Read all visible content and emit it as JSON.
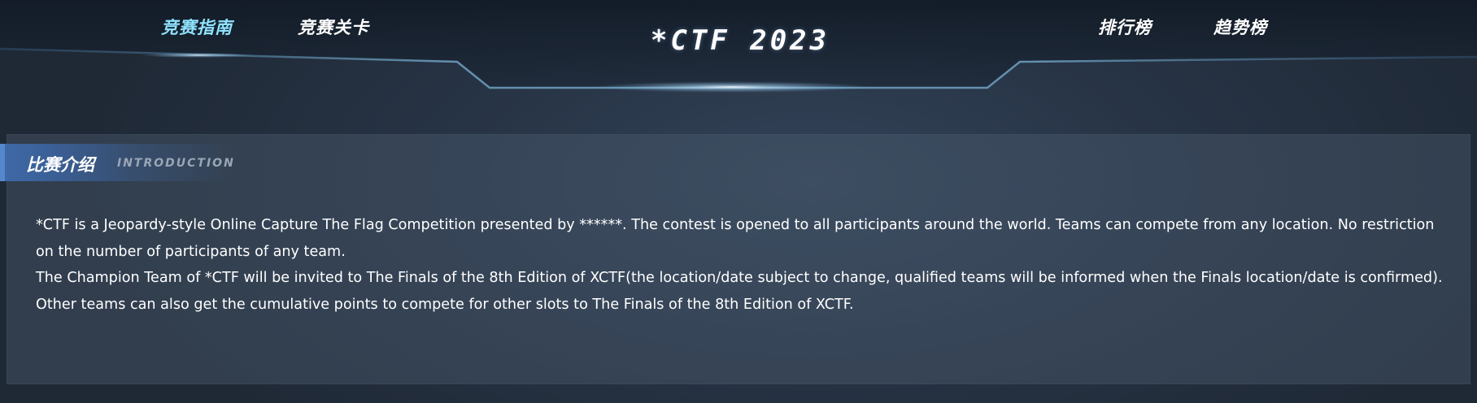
{
  "header": {
    "nav_left": [
      {
        "label": "竞赛指南",
        "active": true
      },
      {
        "label": "竞赛关卡",
        "active": false
      }
    ],
    "nav_right": [
      {
        "label": "排行榜",
        "active": false
      },
      {
        "label": "趋势榜",
        "active": false
      }
    ],
    "title": "*CTF 2023"
  },
  "intro": {
    "title": "比赛介绍",
    "subtitle": "INTRODUCTION",
    "paragraphs": [
      "*CTF is a Jeopardy-style Online Capture The Flag Competition presented by ******. The contest is opened to all participants around the world. Teams can compete from any location. No restriction on the number of participants of any team.",
      "The Champion Team of *CTF will be invited to The Finals of the 8th Edition of XCTF(the location/date subject to change, qualified teams will be informed when the Finals location/date is confirmed).",
      "Other teams can also get the cumulative points to compete for other slots to The Finals of the 8th Edition of XCTF."
    ]
  },
  "colors": {
    "background": "#232f3e",
    "active_nav": "#8fe3ff",
    "frame_line": "#6a9ab8",
    "panel_tab": "#3f6aa8"
  }
}
